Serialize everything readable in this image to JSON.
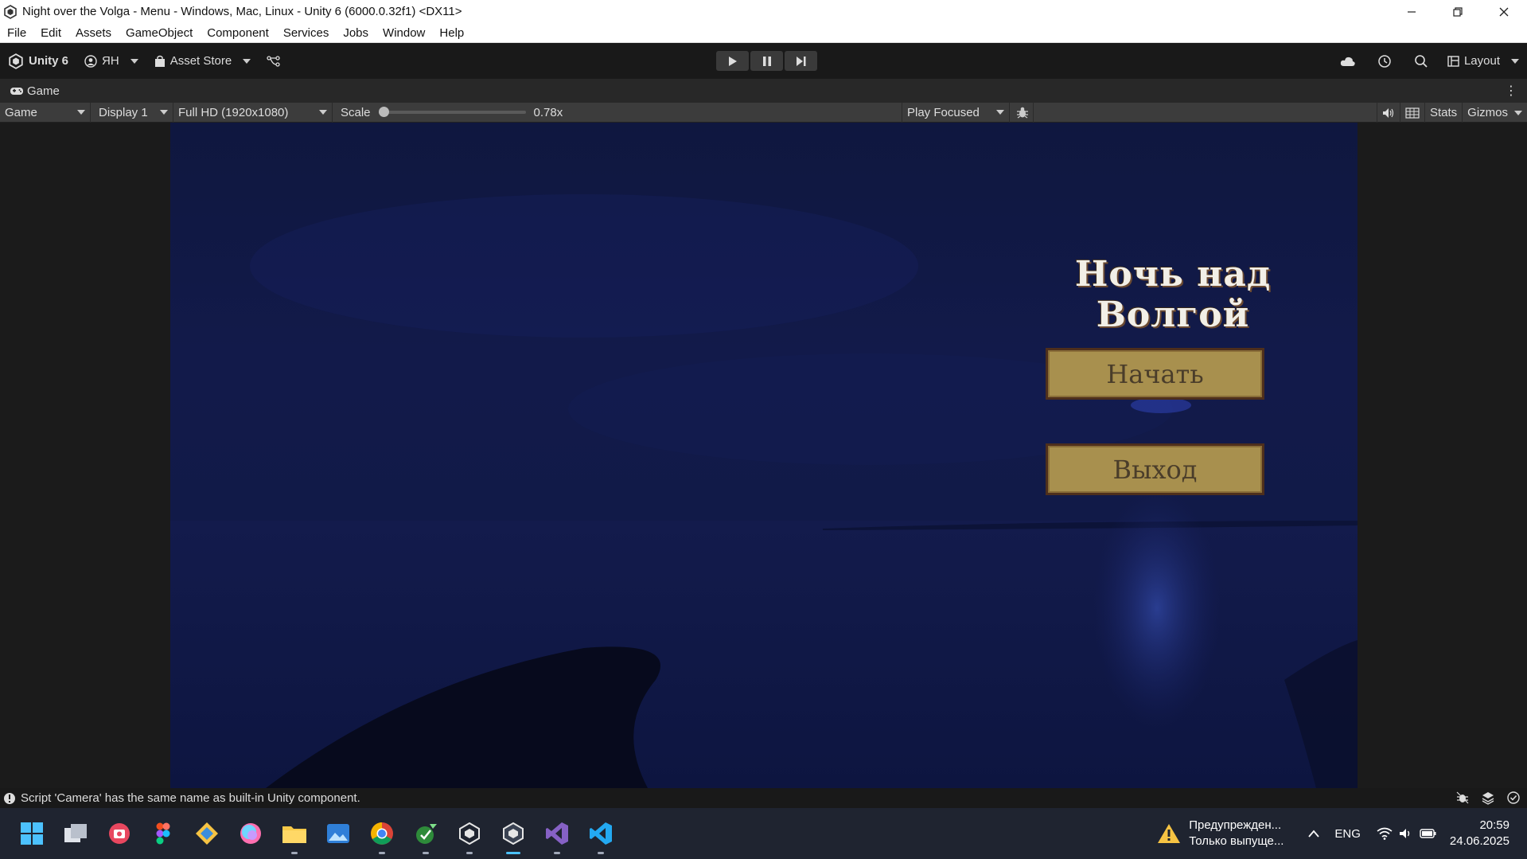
{
  "window": {
    "title": "Night over the Volga - Menu - Windows, Mac, Linux - Unity 6 (6000.0.32f1) <DX11>"
  },
  "menu": [
    "File",
    "Edit",
    "Assets",
    "GameObject",
    "Component",
    "Services",
    "Jobs",
    "Window",
    "Help"
  ],
  "toolbar": {
    "unity_label": "Unity 6",
    "account_label": "ЯН",
    "asset_store_label": "Asset Store",
    "layout_label": "Layout"
  },
  "tab": {
    "label": "Game"
  },
  "gamebar": {
    "view_dropdown": "Game",
    "display_dropdown": "Display 1",
    "resolution_dropdown": "Full HD (1920x1080)",
    "scale_label": "Scale",
    "scale_value": "0.78x",
    "scale_fraction": 0.0,
    "play_mode_dropdown": "Play Focused",
    "stats_label": "Stats",
    "gizmos_label": "Gizmos"
  },
  "game": {
    "title": "Ночь над Волгой",
    "start_button": "Начать",
    "exit_button": "Выход"
  },
  "status": {
    "message": "Script 'Camera' has the same name as built-in Unity component."
  },
  "taskbar": {
    "notification_title": "Предупрежден...",
    "notification_body": "Только выпуще...",
    "language": "ENG",
    "time": "20:59",
    "date": "24.06.2025"
  },
  "colors": {
    "accent": "#4cc2ff",
    "button_fill": "#a8904e",
    "button_border": "#4e2f1c",
    "sky": "#121a4a"
  }
}
